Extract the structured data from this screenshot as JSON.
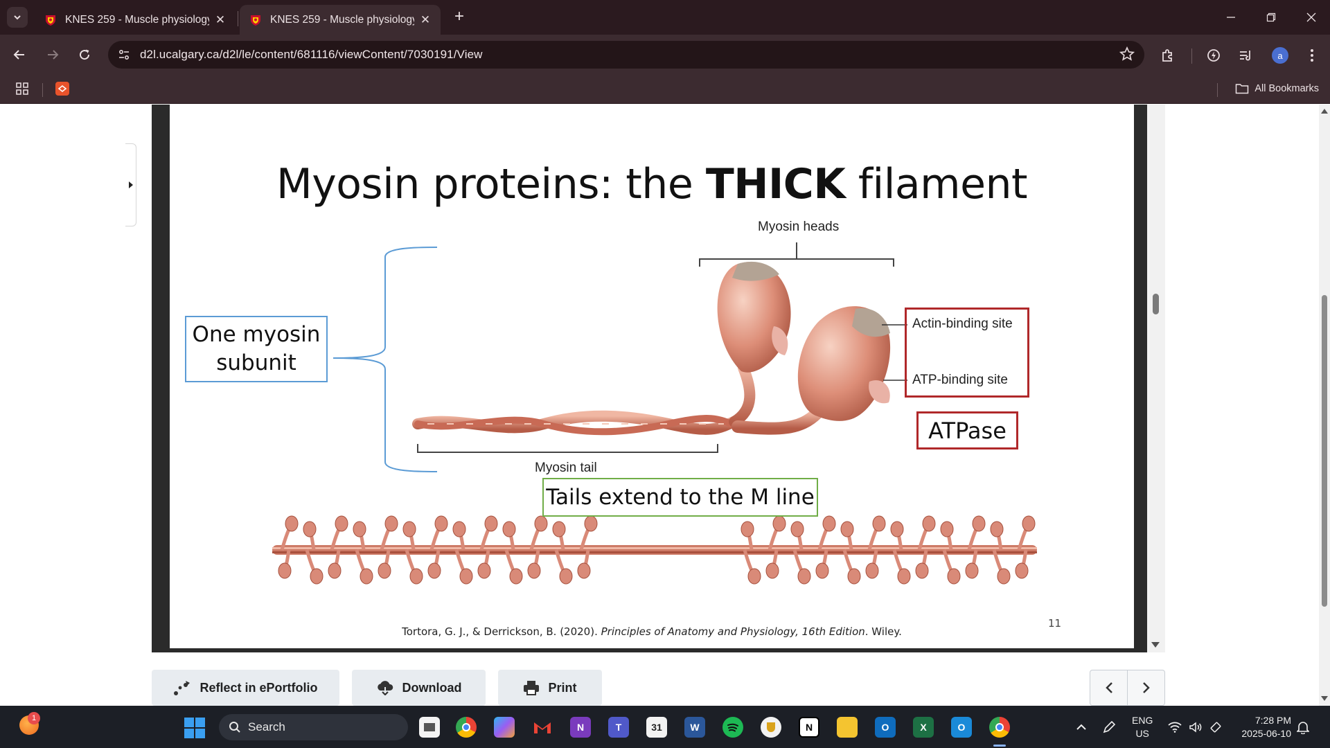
{
  "browser": {
    "tabs": [
      {
        "title": "KNES 259 - Muscle physiology",
        "active": false
      },
      {
        "title": "KNES 259 - Muscle physiology",
        "active": true
      }
    ],
    "address_bar": {
      "url": "d2l.ucalgary.ca/d2l/le/content/681116/viewContent/7030191/View"
    },
    "bookmarks": {
      "all_bookmarks_label": "All Bookmarks"
    },
    "profile_initial": "a"
  },
  "slide": {
    "title_prefix": "Myosin proteins: the ",
    "title_bold": "THICK",
    "title_suffix": " filament",
    "labels": {
      "myosin_heads": "Myosin heads",
      "actin_binding_site": "Actin-binding site",
      "atp_binding_site": "ATP-binding site",
      "myosin_tail": "Myosin tail"
    },
    "boxes": {
      "one_myosin_subunit": "One myosin subunit",
      "atpase": "ATPase",
      "tails_extend": "Tails extend to the M line"
    },
    "slide_number": "11",
    "citation_prefix": "Tortora, G. J., & Derrickson, B. (2020). ",
    "citation_title": "Principles of Anatomy and Physiology, 16th Edition",
    "citation_suffix": ". Wiley.",
    "colors": {
      "blue_box": "#5b9bd5",
      "red_box": "#b0282a",
      "green_box": "#70ad47",
      "myosin": "#d98a78"
    }
  },
  "actions": {
    "reflect_label": "Reflect in ePortfolio",
    "download_label": "Download",
    "print_label": "Print"
  },
  "taskbar": {
    "widget_badge": "1",
    "search_label": "Search",
    "language_line1": "ENG",
    "language_line2": "US",
    "time": "7:28 PM",
    "date": "2025-06-10",
    "apps": [
      "file-explorer-icon",
      "chrome-icon",
      "copilot-icon",
      "gmail-icon",
      "onenote-icon",
      "teams-icon",
      "calendar-icon",
      "word-icon",
      "spotify-icon",
      "vpn-icon",
      "notion-icon",
      "folder-icon",
      "outlook-icon",
      "excel-icon",
      "outlook-new-icon",
      "chrome-profile-icon"
    ],
    "calendar_day": "31"
  }
}
